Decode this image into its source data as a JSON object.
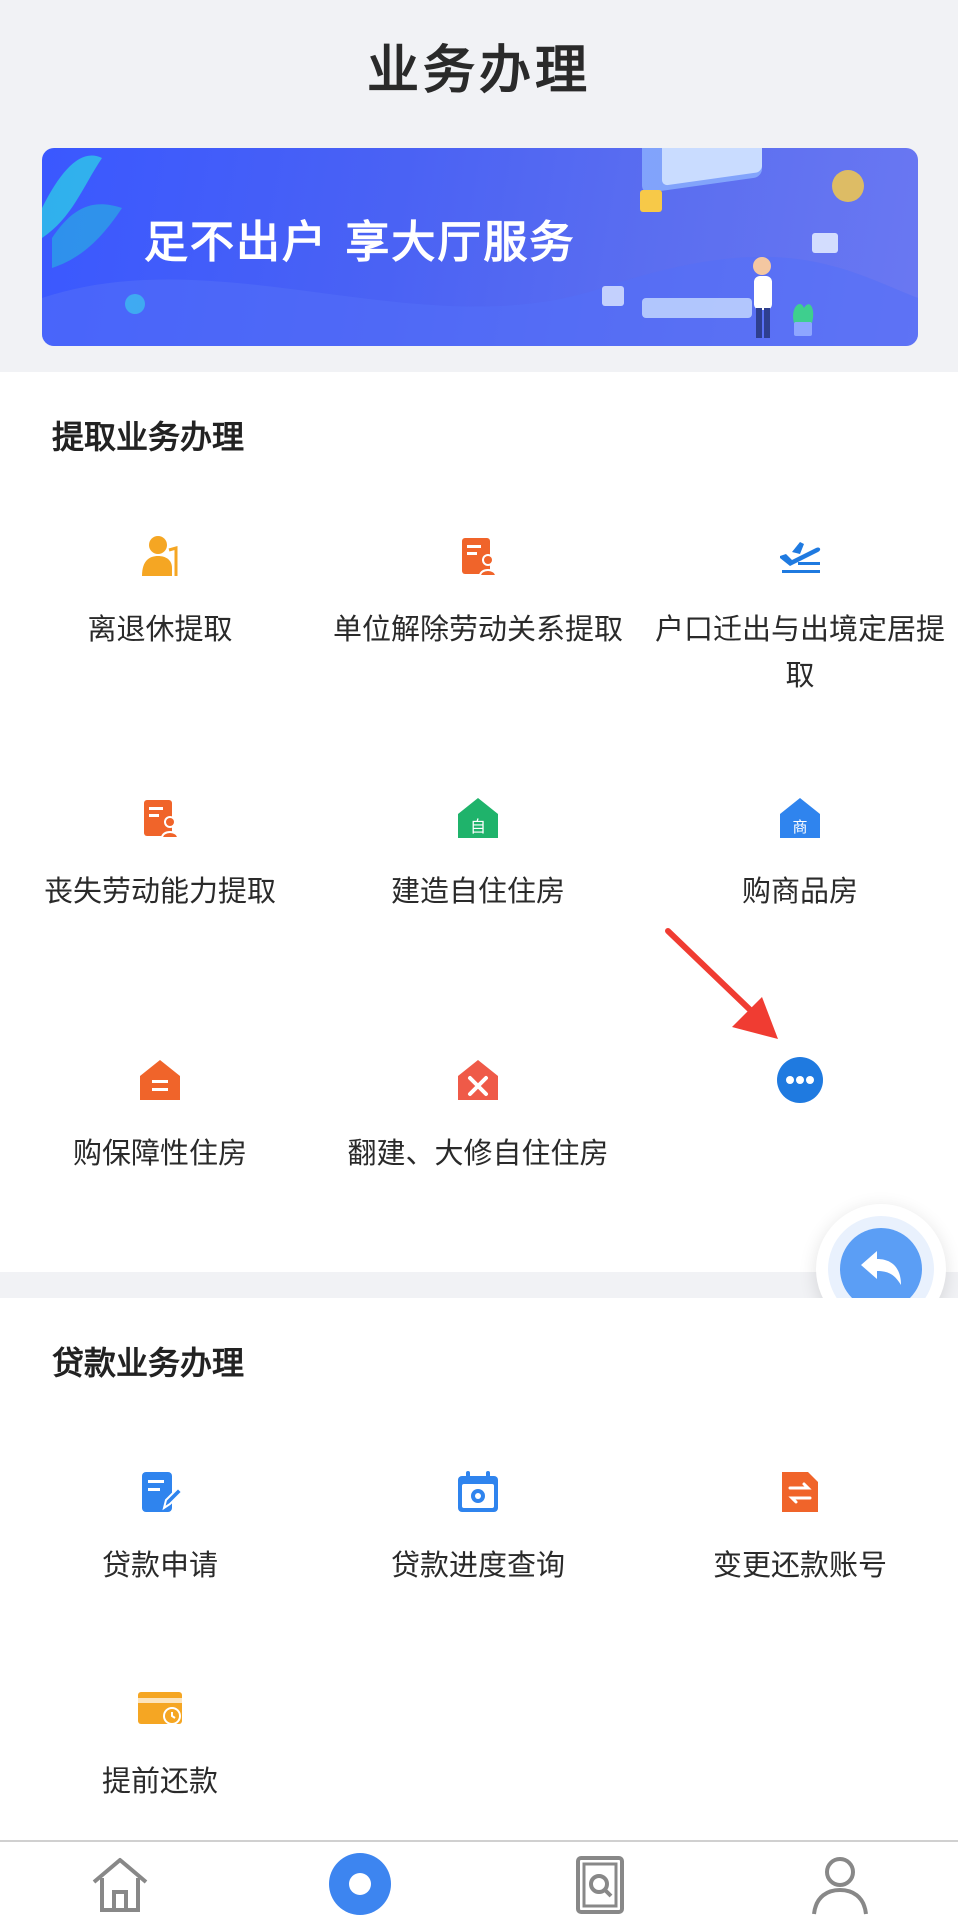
{
  "header": {
    "title": "业务办理"
  },
  "banner": {
    "text": "足不出户 享大厅服务"
  },
  "withdraw_section": {
    "title": "提取业务办理",
    "items": [
      {
        "label": "离退休提取",
        "icon": "elder-person-icon",
        "color": "#f5a623"
      },
      {
        "label": "单位解除劳动关系提取",
        "icon": "document-person-icon",
        "color": "#f0642a"
      },
      {
        "label": "户口迁出与出境定居提取",
        "icon": "airplane-departure-icon",
        "color": "#1f7ae0"
      },
      {
        "label": "丧失劳动能力提取",
        "icon": "document-person-icon",
        "color": "#f0642a"
      },
      {
        "label": "建造自住住房",
        "icon": "house-self-icon",
        "color": "#1fb36b"
      },
      {
        "label": "购商品房",
        "icon": "house-commercial-icon",
        "color": "#2f84ee"
      },
      {
        "label": "购保障性住房",
        "icon": "house-affordable-icon",
        "color": "#f0642a"
      },
      {
        "label": "翻建、大修自住住房",
        "icon": "house-repair-icon",
        "color": "#ef5a48"
      },
      {
        "label": "",
        "icon": "more-icon",
        "color": "#1f7ae0"
      }
    ]
  },
  "loan_section": {
    "title": "贷款业务办理",
    "items": [
      {
        "label": "贷款申请",
        "icon": "edit-form-icon",
        "color": "#2f84ee"
      },
      {
        "label": "贷款进度查询",
        "icon": "calendar-gear-icon",
        "color": "#2f84ee"
      },
      {
        "label": "变更还款账号",
        "icon": "document-transfer-icon",
        "color": "#f0642a"
      },
      {
        "label": "提前还款",
        "icon": "card-clock-icon",
        "color": "#f5a623"
      }
    ]
  },
  "tabbar": {
    "items": [
      {
        "icon": "home-icon",
        "active": false
      },
      {
        "icon": "business-icon",
        "active": true
      },
      {
        "icon": "search-document-icon",
        "active": false
      },
      {
        "icon": "user-icon",
        "active": false
      }
    ]
  },
  "colors": {
    "accent": "#1f7ae0",
    "annotation": "#f03c32",
    "fab": "#5b9ef5"
  }
}
